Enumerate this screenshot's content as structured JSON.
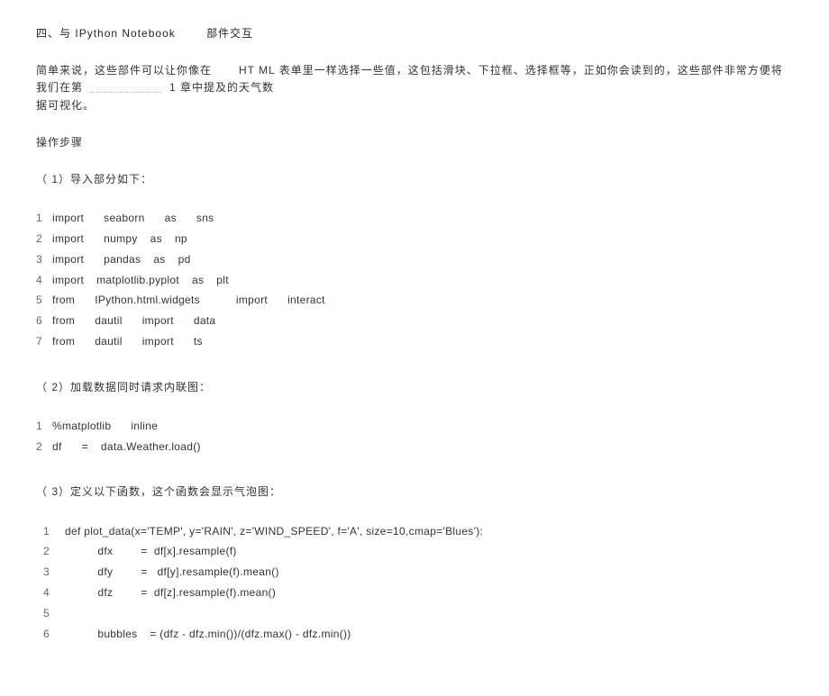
{
  "heading": {
    "prefix": "四、与",
    "term": "IPython Notebook",
    "suffix": "部件交互"
  },
  "intro": {
    "t1": "简单来说，这些部件可以让你像在",
    "t2": "HT ML",
    "t3": "表单里一样选择一些值，这包括滑块、下拉框、选择框等，正如你会读到的，这些部件非常方便将我们在第",
    "t4": "1 章中提及的天气数",
    "t5": "据可视化。"
  },
  "steps_header": "操作步骤",
  "step1": "（ 1）导入部分如下：",
  "code1": {
    "l1": {
      "n": "1",
      "a": "import",
      "b": "seaborn",
      "c": "as",
      "d": "sns"
    },
    "l2": {
      "n": "2",
      "a": "import",
      "b": "numpy",
      "c": "as",
      "d": "np"
    },
    "l3": {
      "n": "3",
      "a": "import",
      "b": "pandas",
      "c": "as",
      "d": "pd"
    },
    "l4": {
      "n": "4",
      "a": "import",
      "b": "matplotlib.pyplot",
      "c": "as",
      "d": "plt"
    },
    "l5": {
      "n": "5",
      "a": "from",
      "b": "IPython.html.widgets",
      "c": "import",
      "d": "interact"
    },
    "l6": {
      "n": "6",
      "a": "from",
      "b": "dautil",
      "c": "import",
      "d": "data"
    },
    "l7": {
      "n": "7",
      "a": "from",
      "b": "dautil",
      "c": "import",
      "d": "ts"
    }
  },
  "step2": "（ 2）加载数据同时请求内联图：",
  "code2": {
    "l1": {
      "n": "1",
      "a": "%matplotlib",
      "b": "inline"
    },
    "l2": {
      "n": "2",
      "a": "df",
      "b": "=",
      "c": "data.Weather.load()"
    }
  },
  "step3": "（ 3）定义以下函数，这个函数会显示气泡图：",
  "code3": {
    "l1": {
      "n": "1",
      "c": "def plot_data(x='TEMP', y='RAIN', z='WIND_SPEED', f='A', size=10,cmap='Blues'):"
    },
    "l2": {
      "n": "2",
      "a": "dfx",
      "b": "=  df[x].resample(f)"
    },
    "l3": {
      "n": "3",
      "a": "dfy",
      "b": "=   df[y].resample(f).mean()"
    },
    "l4": {
      "n": "4",
      "a": "dfz",
      "b": "=  df[z].resample(f).mean()"
    },
    "l5": {
      "n": "5",
      "c": ""
    },
    "l6": {
      "n": "6",
      "a": "bubbles",
      "b": "= (dfz - dfz.min())/(dfz.max() - dfz.min())"
    }
  }
}
